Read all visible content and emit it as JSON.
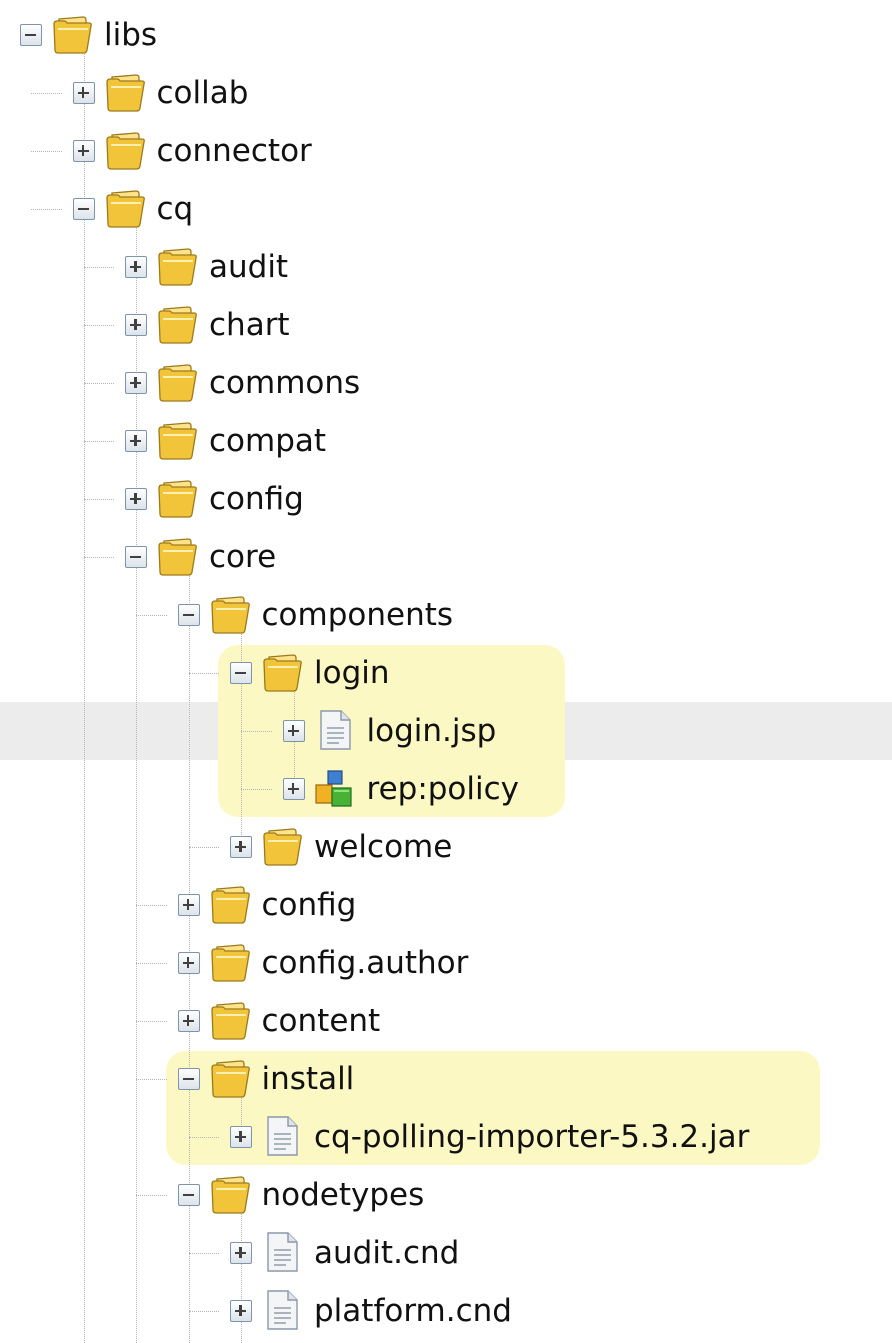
{
  "tree": [
    {
      "label": "libs",
      "depth": 0,
      "state": "expanded",
      "icon": "folder-icon"
    },
    {
      "label": "collab",
      "depth": 1,
      "state": "collapsed",
      "icon": "folder-icon"
    },
    {
      "label": "connector",
      "depth": 1,
      "state": "collapsed",
      "icon": "folder-icon"
    },
    {
      "label": "cq",
      "depth": 1,
      "state": "expanded",
      "icon": "folder-icon"
    },
    {
      "label": "audit",
      "depth": 2,
      "state": "collapsed",
      "icon": "folder-icon"
    },
    {
      "label": "chart",
      "depth": 2,
      "state": "collapsed",
      "icon": "folder-icon"
    },
    {
      "label": "commons",
      "depth": 2,
      "state": "collapsed",
      "icon": "folder-icon"
    },
    {
      "label": "compat",
      "depth": 2,
      "state": "collapsed",
      "icon": "folder-icon"
    },
    {
      "label": "config",
      "depth": 2,
      "state": "collapsed",
      "icon": "folder-icon"
    },
    {
      "label": "core",
      "depth": 2,
      "state": "expanded",
      "icon": "folder-icon"
    },
    {
      "label": "components",
      "depth": 3,
      "state": "expanded",
      "icon": "folder-icon"
    },
    {
      "label": "login",
      "depth": 4,
      "state": "expanded",
      "icon": "folder-icon"
    },
    {
      "label": "login.jsp",
      "depth": 5,
      "state": "collapsed",
      "icon": "file-icon",
      "selected": true
    },
    {
      "label": "rep:policy",
      "depth": 5,
      "state": "collapsed",
      "icon": "policy-icon"
    },
    {
      "label": "welcome",
      "depth": 4,
      "state": "collapsed",
      "icon": "folder-icon"
    },
    {
      "label": "config",
      "depth": 3,
      "state": "collapsed",
      "icon": "folder-icon"
    },
    {
      "label": "config.author",
      "depth": 3,
      "state": "collapsed",
      "icon": "folder-icon"
    },
    {
      "label": "content",
      "depth": 3,
      "state": "collapsed",
      "icon": "folder-icon"
    },
    {
      "label": "install",
      "depth": 3,
      "state": "expanded",
      "icon": "folder-icon"
    },
    {
      "label": "cq-polling-importer-5.3.2.jar",
      "depth": 4,
      "state": "collapsed",
      "icon": "file-icon"
    },
    {
      "label": "nodetypes",
      "depth": 3,
      "state": "expanded",
      "icon": "folder-icon"
    },
    {
      "label": "audit.cnd",
      "depth": 4,
      "state": "collapsed",
      "icon": "file-icon"
    },
    {
      "label": "platform.cnd",
      "depth": 4,
      "state": "collapsed",
      "icon": "file-icon"
    }
  ],
  "highlight_groups": [
    [
      "login",
      "rep:policy"
    ],
    [
      "install",
      "cq-polling-importer-5.3.2.jar"
    ]
  ],
  "colors": {
    "highlight": "#fbf8c4",
    "selected_row": "#ececec",
    "folder": "#f2c43a",
    "toggle_border": "#7e93ac"
  }
}
